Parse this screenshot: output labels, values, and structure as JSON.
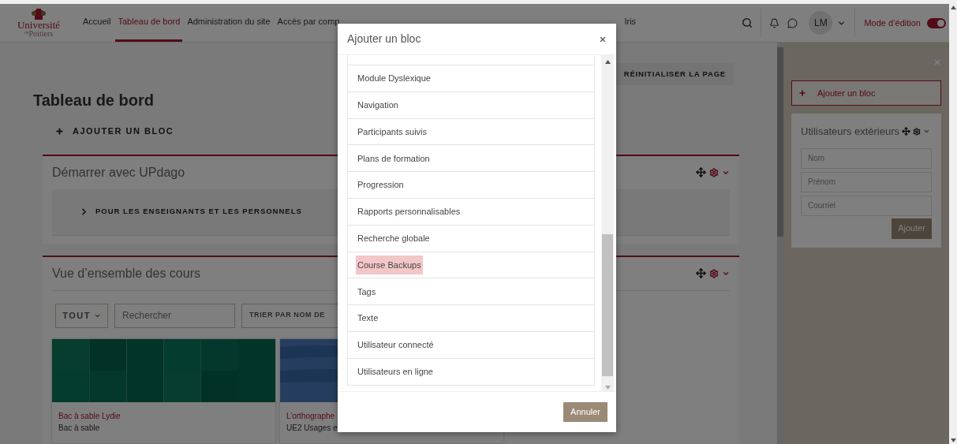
{
  "nav": {
    "logo": {
      "line1": "Université",
      "line2_small": "de",
      "line2": "Poitiers"
    },
    "menu": [
      {
        "label": "Accueil",
        "selected": false
      },
      {
        "label": "Tableau de bord",
        "selected": true
      },
      {
        "label": "Administration du site",
        "selected": false
      },
      {
        "label": "Accès par comp",
        "selected": false
      }
    ],
    "menu_after_dialog": [
      {
        "label": "Iris",
        "selected": false
      }
    ],
    "user": {
      "initials": "LM"
    },
    "edit_mode": {
      "label": "Mode d’édition",
      "on": true
    }
  },
  "page": {
    "reset_button": "RÉINITIALISER LA PAGE",
    "title": "Tableau de bord",
    "add_block": "AJOUTER UN BLOC",
    "blocks": [
      {
        "kind": "collapsible",
        "title": "Démarrer avec UPdago",
        "section": {
          "label": "POUR LES ENSEIGNANTS ET LES PERSONNELS",
          "expanded": false
        }
      },
      {
        "kind": "courses",
        "title": "Vue d’ensemble des cours",
        "filter": "TOUT",
        "search_placeholder": "Rechercher",
        "sort": "TRIER PAR NOM DE",
        "courses": [
          {
            "name": "Bac à sable Lydie",
            "category": "Bac à sable"
          },
          {
            "name": "L’orthographe",
            "category": "UE2 Usages e"
          }
        ]
      }
    ]
  },
  "drawer": {
    "add_block": "Ajouter un bloc",
    "block": {
      "title": "Utilisateurs extérieurs",
      "fields": [
        {
          "placeholder": "Nom"
        },
        {
          "placeholder": "Prénom"
        },
        {
          "placeholder": "Courriel"
        }
      ],
      "button": "Ajouter"
    }
  },
  "dialog": {
    "title": "Ajouter un bloc",
    "items": [
      {
        "label": "Module Dyslexique",
        "highlighted": false
      },
      {
        "label": "Navigation",
        "highlighted": false
      },
      {
        "label": "Participants suivis",
        "highlighted": false
      },
      {
        "label": "Plans de formation",
        "highlighted": false
      },
      {
        "label": "Progression",
        "highlighted": false
      },
      {
        "label": "Rapports personnalisables",
        "highlighted": false
      },
      {
        "label": "Recherche globale",
        "highlighted": false
      },
      {
        "label": "Course Backups",
        "highlighted": true
      },
      {
        "label": "Tags",
        "highlighted": false
      },
      {
        "label": "Texte",
        "highlighted": false
      },
      {
        "label": "Utilisateur connecté",
        "highlighted": false
      },
      {
        "label": "Utilisateurs en ligne",
        "highlighted": false
      }
    ],
    "cancel": "Annuler"
  }
}
